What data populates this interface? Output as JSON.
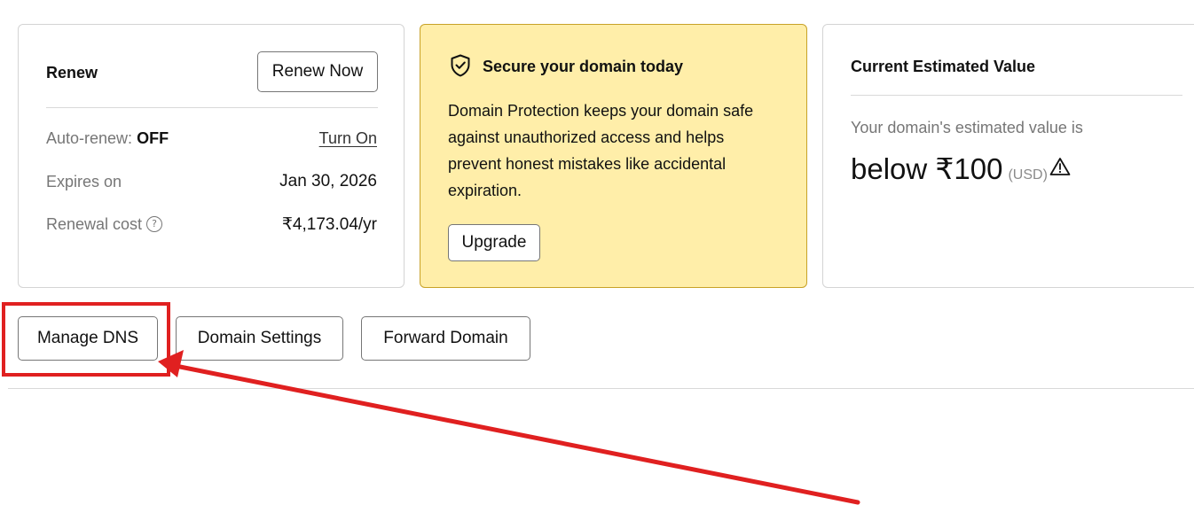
{
  "renew_card": {
    "title": "Renew",
    "renew_now_label": "Renew Now",
    "auto_renew_label": "Auto-renew:",
    "auto_renew_status": "OFF",
    "turn_on_label": "Turn On",
    "expires_label": "Expires on",
    "expires_value": "Jan 30, 2026",
    "renewal_cost_label": "Renewal cost",
    "renewal_cost_help_icon": "question-circle-icon",
    "renewal_cost_value": "₹4,173.04/yr"
  },
  "secure_card": {
    "icon": "shield-check-icon",
    "title": "Secure your domain today",
    "body": "Domain Protection keeps your domain safe against unauthorized access and helps prevent honest mistakes like accidental expiration.",
    "upgrade_label": "Upgrade",
    "background_color": "#ffeea9"
  },
  "value_card": {
    "title": "Current Estimated Value",
    "estimate_label": "Your domain's estimated value is",
    "estimate_amount": "below ₹100",
    "estimate_currency": "(USD)",
    "warning_icon": "warning-triangle-icon"
  },
  "actions": {
    "manage_dns_label": "Manage DNS",
    "domain_settings_label": "Domain Settings",
    "forward_domain_label": "Forward Domain"
  },
  "annotation": {
    "color": "#e02020",
    "highlight": "Manage DNS"
  }
}
